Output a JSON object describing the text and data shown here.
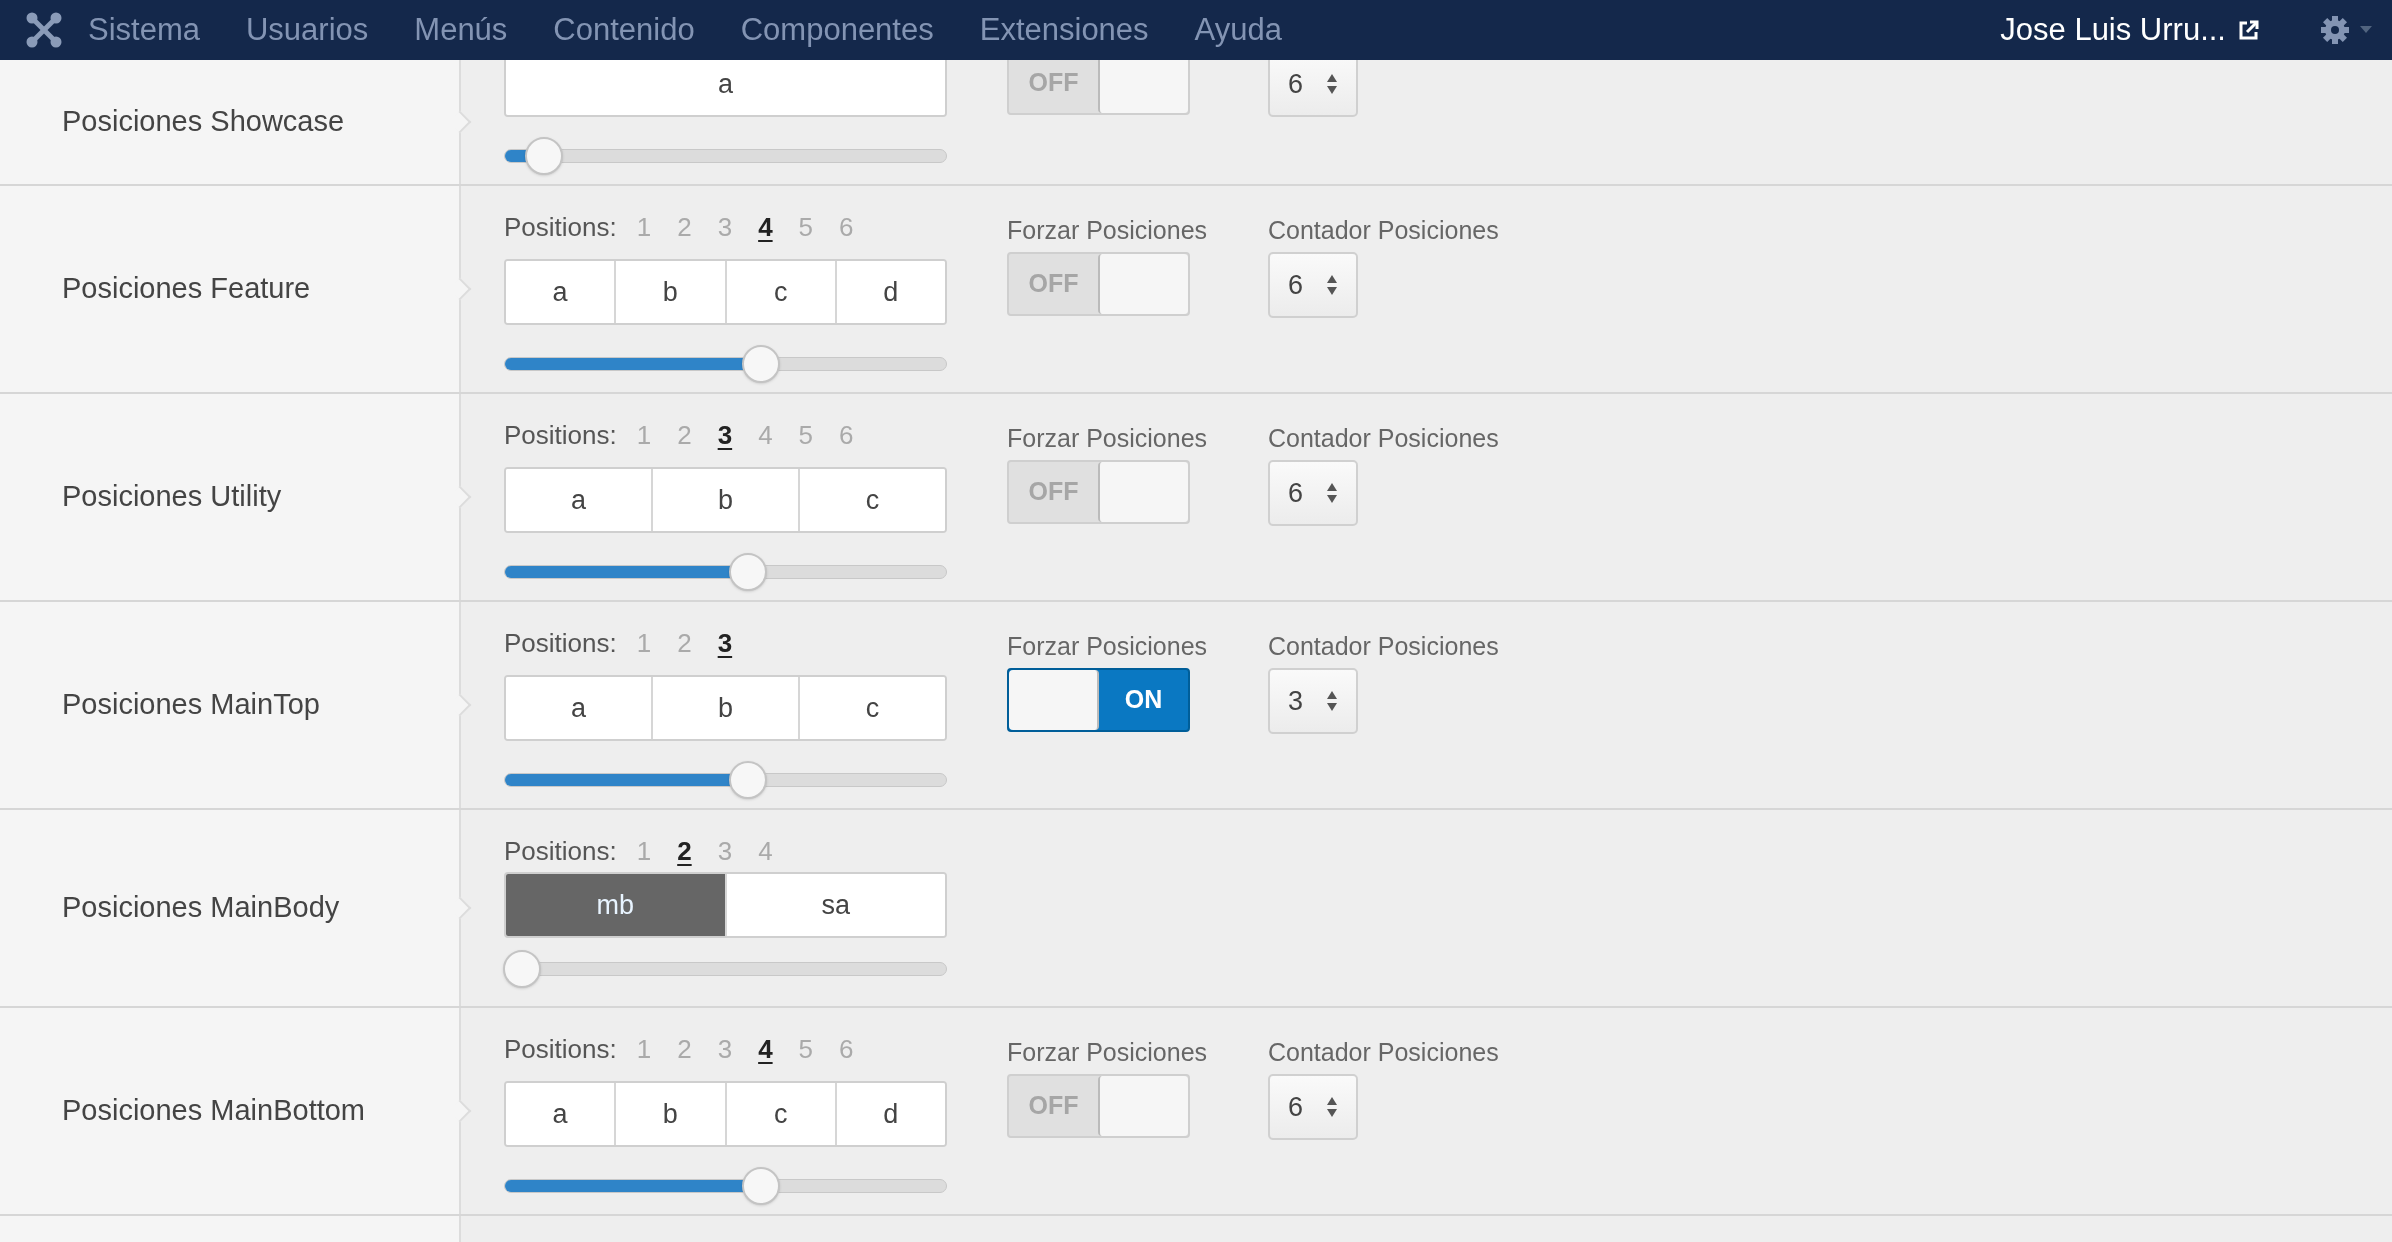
{
  "navbar": {
    "menu": [
      "Sistema",
      "Usuarios",
      "Menús",
      "Contenido",
      "Componentes",
      "Extensiones",
      "Ayuda"
    ],
    "user": "Jose Luis Urru..."
  },
  "rows": [
    {
      "label": "Posiciones Showcase",
      "segments": [
        {
          "text": "a",
          "selected": false
        }
      ],
      "slider": {
        "level": 0.09
      },
      "toggle": {
        "on": false,
        "text": "OFF"
      },
      "counter": {
        "value": "6"
      }
    },
    {
      "label": "Posiciones Feature",
      "positions_label": "Positions:",
      "positions": [
        {
          "text": "1",
          "selected": false
        },
        {
          "text": "2",
          "selected": false
        },
        {
          "text": "3",
          "selected": false
        },
        {
          "text": "4",
          "selected": true
        },
        {
          "text": "5",
          "selected": false
        },
        {
          "text": "6",
          "selected": false
        }
      ],
      "segments": [
        {
          "text": "a",
          "selected": false
        },
        {
          "text": "b",
          "selected": false
        },
        {
          "text": "c",
          "selected": false
        },
        {
          "text": "d",
          "selected": false
        }
      ],
      "slider": {
        "level": 0.58
      },
      "toggle": {
        "label": "Forzar Posiciones",
        "on": false,
        "text": "OFF"
      },
      "counter": {
        "label": "Contador Posiciones",
        "value": "6"
      }
    },
    {
      "label": "Posiciones Utility",
      "positions_label": "Positions:",
      "positions": [
        {
          "text": "1",
          "selected": false
        },
        {
          "text": "2",
          "selected": false
        },
        {
          "text": "3",
          "selected": true
        },
        {
          "text": "4",
          "selected": false
        },
        {
          "text": "5",
          "selected": false
        },
        {
          "text": "6",
          "selected": false
        }
      ],
      "segments": [
        {
          "text": "a",
          "selected": false
        },
        {
          "text": "b",
          "selected": false
        },
        {
          "text": "c",
          "selected": false
        }
      ],
      "slider": {
        "level": 0.55
      },
      "toggle": {
        "label": "Forzar Posiciones",
        "on": false,
        "text": "OFF"
      },
      "counter": {
        "label": "Contador Posiciones",
        "value": "6"
      }
    },
    {
      "label": "Posiciones MainTop",
      "positions_label": "Positions:",
      "positions": [
        {
          "text": "1",
          "selected": false
        },
        {
          "text": "2",
          "selected": false
        },
        {
          "text": "3",
          "selected": true
        }
      ],
      "segments": [
        {
          "text": "a",
          "selected": false
        },
        {
          "text": "b",
          "selected": false
        },
        {
          "text": "c",
          "selected": false
        }
      ],
      "slider": {
        "level": 0.55
      },
      "toggle": {
        "label": "Forzar Posiciones",
        "on": true,
        "text": "ON"
      },
      "counter": {
        "label": "Contador Posiciones",
        "value": "3"
      }
    },
    {
      "label": "Posiciones MainBody",
      "positions_label": "Positions:",
      "positions": [
        {
          "text": "1",
          "selected": false
        },
        {
          "text": "2",
          "selected": true
        },
        {
          "text": "3",
          "selected": false
        },
        {
          "text": "4",
          "selected": false
        }
      ],
      "segments": [
        {
          "text": "mb",
          "selected": true
        },
        {
          "text": "sa",
          "selected": false
        }
      ],
      "slider": {
        "level": 0.04
      }
    },
    {
      "label": "Posiciones MainBottom",
      "positions_label": "Positions:",
      "positions": [
        {
          "text": "1",
          "selected": false
        },
        {
          "text": "2",
          "selected": false
        },
        {
          "text": "3",
          "selected": false
        },
        {
          "text": "4",
          "selected": true
        },
        {
          "text": "5",
          "selected": false
        },
        {
          "text": "6",
          "selected": false
        }
      ],
      "segments": [
        {
          "text": "a",
          "selected": false
        },
        {
          "text": "b",
          "selected": false
        },
        {
          "text": "c",
          "selected": false
        },
        {
          "text": "d",
          "selected": false
        }
      ],
      "slider": {
        "level": 0.58
      },
      "toggle": {
        "label": "Forzar Posiciones",
        "on": false,
        "text": "OFF"
      },
      "counter": {
        "label": "Contador Posiciones",
        "value": "6"
      }
    }
  ]
}
